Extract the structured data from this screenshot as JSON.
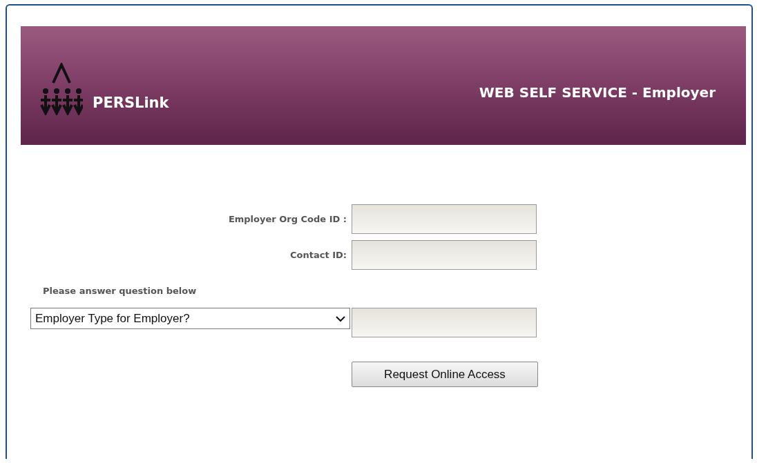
{
  "header": {
    "brand": "PERSLink",
    "title": "WEB SELF SERVICE - Employer"
  },
  "form": {
    "fields": [
      {
        "label": "Employer Org Code ID :"
      },
      {
        "label": "Contact ID:"
      }
    ],
    "question_prompt": "Please answer question below",
    "question_dropdown": {
      "value": "Employer Type for Employer?"
    },
    "submit_button": "Request Online Access"
  }
}
